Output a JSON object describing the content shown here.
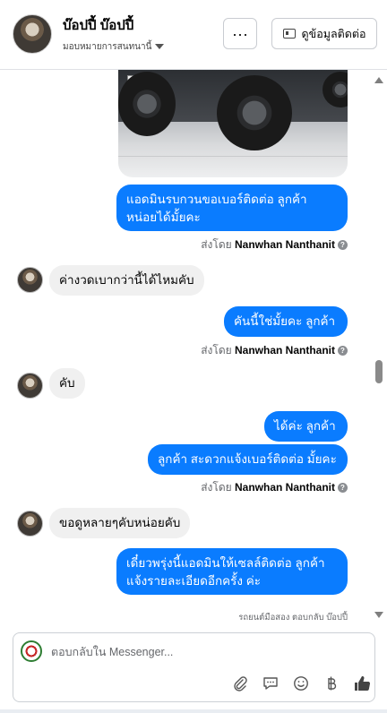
{
  "header": {
    "contact_name": "บ๊อปปี้ บ๊อปปี้",
    "assign_label": "มอบหมายการสนทนานี้",
    "more_label": "···",
    "contact_button_label": "ดูข้อมูลติดต่อ"
  },
  "messages": [
    {
      "direction": "outgoing",
      "lines": [
        "แอดมินรบกวนขอเบอร์ติดต่อ ลูกค้า",
        "หน่อยได้มั้ยคะ"
      ]
    },
    {
      "direction": "incoming",
      "text": "ค่างวดเบากว่านี้ได้ไหมคับ"
    },
    {
      "direction": "outgoing",
      "text": "คันนี้ใช่มั้ยคะ  ลูกค้า"
    },
    {
      "direction": "incoming",
      "text": "คับ"
    },
    {
      "direction": "outgoing",
      "text": "ได้ค่ะ  ลูกค้า"
    },
    {
      "direction": "outgoing",
      "text": "ลูกค้า สะดวกแจ้งเบอร์ติดต่อ มั้ยคะ"
    },
    {
      "direction": "incoming",
      "text": "ขอดูหลายๆคับหน่อยคับ"
    },
    {
      "direction": "outgoing",
      "lines": [
        "เดี๋ยวพรุ่งนี้แอดมินให้เซลล์ติดต่อ ลูกค้า",
        "แจ้งรายละเอียดอีกครั้ง ค่ะ"
      ]
    }
  ],
  "sent_by": {
    "prefix": "ส่งโดย",
    "name": "Nanwhan Nanthanit",
    "info": "?"
  },
  "reply_note": "รถยนต์มือสอง ตอบกลับ บ๊อปปี้",
  "composer": {
    "placeholder": "ตอบกลับใน Messenger...",
    "tools": [
      "paperclip-icon",
      "saved-reply-icon",
      "emoji-icon",
      "baht-icon",
      "thumbs-up-icon"
    ]
  },
  "colors": {
    "outgoing_bubble": "#0a7cff",
    "incoming_bubble": "#f0f0f0"
  }
}
